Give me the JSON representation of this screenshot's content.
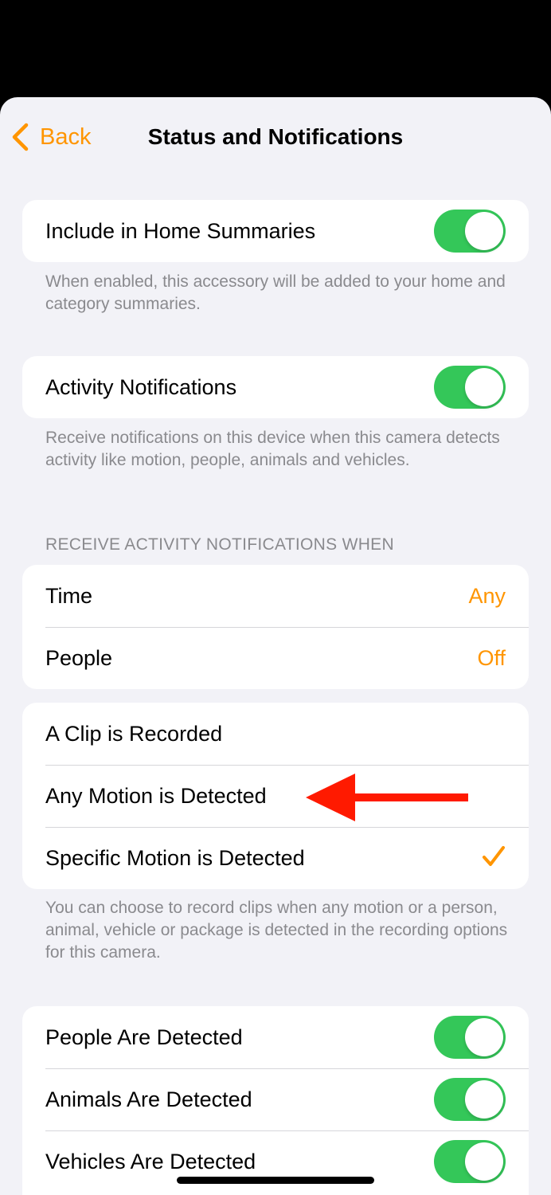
{
  "nav": {
    "back_label": "Back",
    "title": "Status and Notifications"
  },
  "home_summaries": {
    "label": "Include in Home Summaries",
    "enabled": true,
    "footnote": "When enabled, this accessory will be added to your home and category summaries."
  },
  "activity": {
    "label": "Activity Notifications",
    "enabled": true,
    "footnote": "Receive notifications on this device when this camera detects activity like motion, people, animals and vehicles."
  },
  "receive_section": {
    "header": "RECEIVE ACTIVITY NOTIFICATIONS WHEN",
    "rows": [
      {
        "label": "Time",
        "value": "Any"
      },
      {
        "label": "People",
        "value": "Off"
      }
    ]
  },
  "motion_options": {
    "rows": [
      {
        "label": "A Clip is Recorded",
        "selected": false
      },
      {
        "label": "Any Motion is Detected",
        "selected": false
      },
      {
        "label": "Specific Motion is Detected",
        "selected": true
      }
    ],
    "footnote": "You can choose to record clips when any motion or a person, animal, vehicle or package is detected in the recording options for this camera."
  },
  "detections": {
    "rows": [
      {
        "label": "People Are Detected",
        "enabled": true
      },
      {
        "label": "Animals Are Detected",
        "enabled": true
      },
      {
        "label": "Vehicles Are Detected",
        "enabled": true
      }
    ]
  },
  "colors": {
    "accent": "#ff9500",
    "toggle_on": "#34c759",
    "background": "#f2f2f7",
    "annotation_arrow": "#ff1a00"
  },
  "icons": {
    "back": "chevron-left-icon",
    "check": "checkmark-icon",
    "annotation": "red-arrow-annotation"
  }
}
